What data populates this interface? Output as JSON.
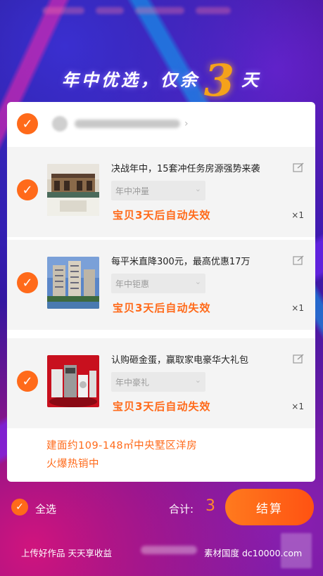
{
  "headline": {
    "prefix": "年中优选，仅余",
    "number": "3",
    "suffix": "天"
  },
  "shop": {
    "name_hidden": true
  },
  "items": [
    {
      "title": "决战年中，15套冲任务房源强势来袭",
      "variant": "年中冲量",
      "warning": "宝贝3天后自动失效",
      "qty": "×1"
    },
    {
      "title": "每平米直降300元，最高优惠17万",
      "variant": "年中钜惠",
      "warning": "宝贝3天后自动失效",
      "qty": "×1"
    },
    {
      "title": "认购砸金蛋，赢取家电豪华大礼包",
      "variant": "年中豪礼",
      "warning": "宝贝3天后自动失效",
      "qty": "×1"
    }
  ],
  "promo": {
    "line1": "建面约109-148㎡中央墅区洋房",
    "line2": "火爆热销中"
  },
  "footer": {
    "select_all": "全选",
    "total_label": "合计:",
    "total_value": "3",
    "checkout": "结算"
  },
  "watermark": {
    "left": "上传好作品  天天享收益",
    "right": "素材国度  dc10000.com"
  },
  "colors": {
    "accent": "#ff6a1a",
    "total": "#ff8a2a"
  }
}
